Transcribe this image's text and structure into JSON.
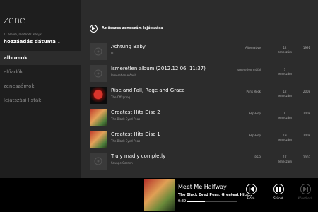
{
  "sidebar": {
    "title": "zene",
    "subtitle": "11 album, rendezés alapja:",
    "sort_label": "hozzáadás dátuma",
    "nav": [
      {
        "label": "albumok",
        "active": true
      },
      {
        "label": "előadók",
        "active": false
      },
      {
        "label": "zeneszámok",
        "active": false
      },
      {
        "label": "lejátszási listák",
        "active": false
      }
    ]
  },
  "main": {
    "play_all_label": "Az összes zeneszám lejátszása",
    "albums": [
      {
        "title": "Achtung Baby",
        "artist": "U2",
        "genre": "Alternative",
        "count": "12",
        "count_unit": "zeneszám",
        "year": "1991"
      },
      {
        "title": "Ismeretlen album (2012.12.06. 11:37)",
        "artist": "Ismeretlen előadó",
        "genre": "Ismeretlen műfaj",
        "count": "1",
        "count_unit": "zeneszám",
        "year": ""
      },
      {
        "title": "Rise and Fall, Rage and Grace",
        "artist": "The Offspring",
        "genre": "Punk Rock",
        "count": "12",
        "count_unit": "zeneszám",
        "year": "2008"
      },
      {
        "title": "Greatest Hits Disc 2",
        "artist": "The Black Eyed Peas",
        "genre": "Hip-Hop",
        "count": "9",
        "count_unit": "zeneszám",
        "year": "2008"
      },
      {
        "title": "Greatest Hits Disc 1",
        "artist": "The Black Eyed Peas",
        "genre": "Hip-Hop",
        "count": "19",
        "count_unit": "zeneszám",
        "year": "2008"
      },
      {
        "title": "Truly madly completly",
        "artist": "Savage Garden",
        "genre": "R&B",
        "count": "17",
        "count_unit": "zeneszám",
        "year": "2003"
      }
    ]
  },
  "player": {
    "title": "Meet Me Halfway",
    "subtitle": "The Black Eyed Peas, Greatest Hits...",
    "time": "0:39",
    "progress": 0.35,
    "prev_label": "Előző",
    "pause_label": "Szünet",
    "next_label": "Következő"
  }
}
